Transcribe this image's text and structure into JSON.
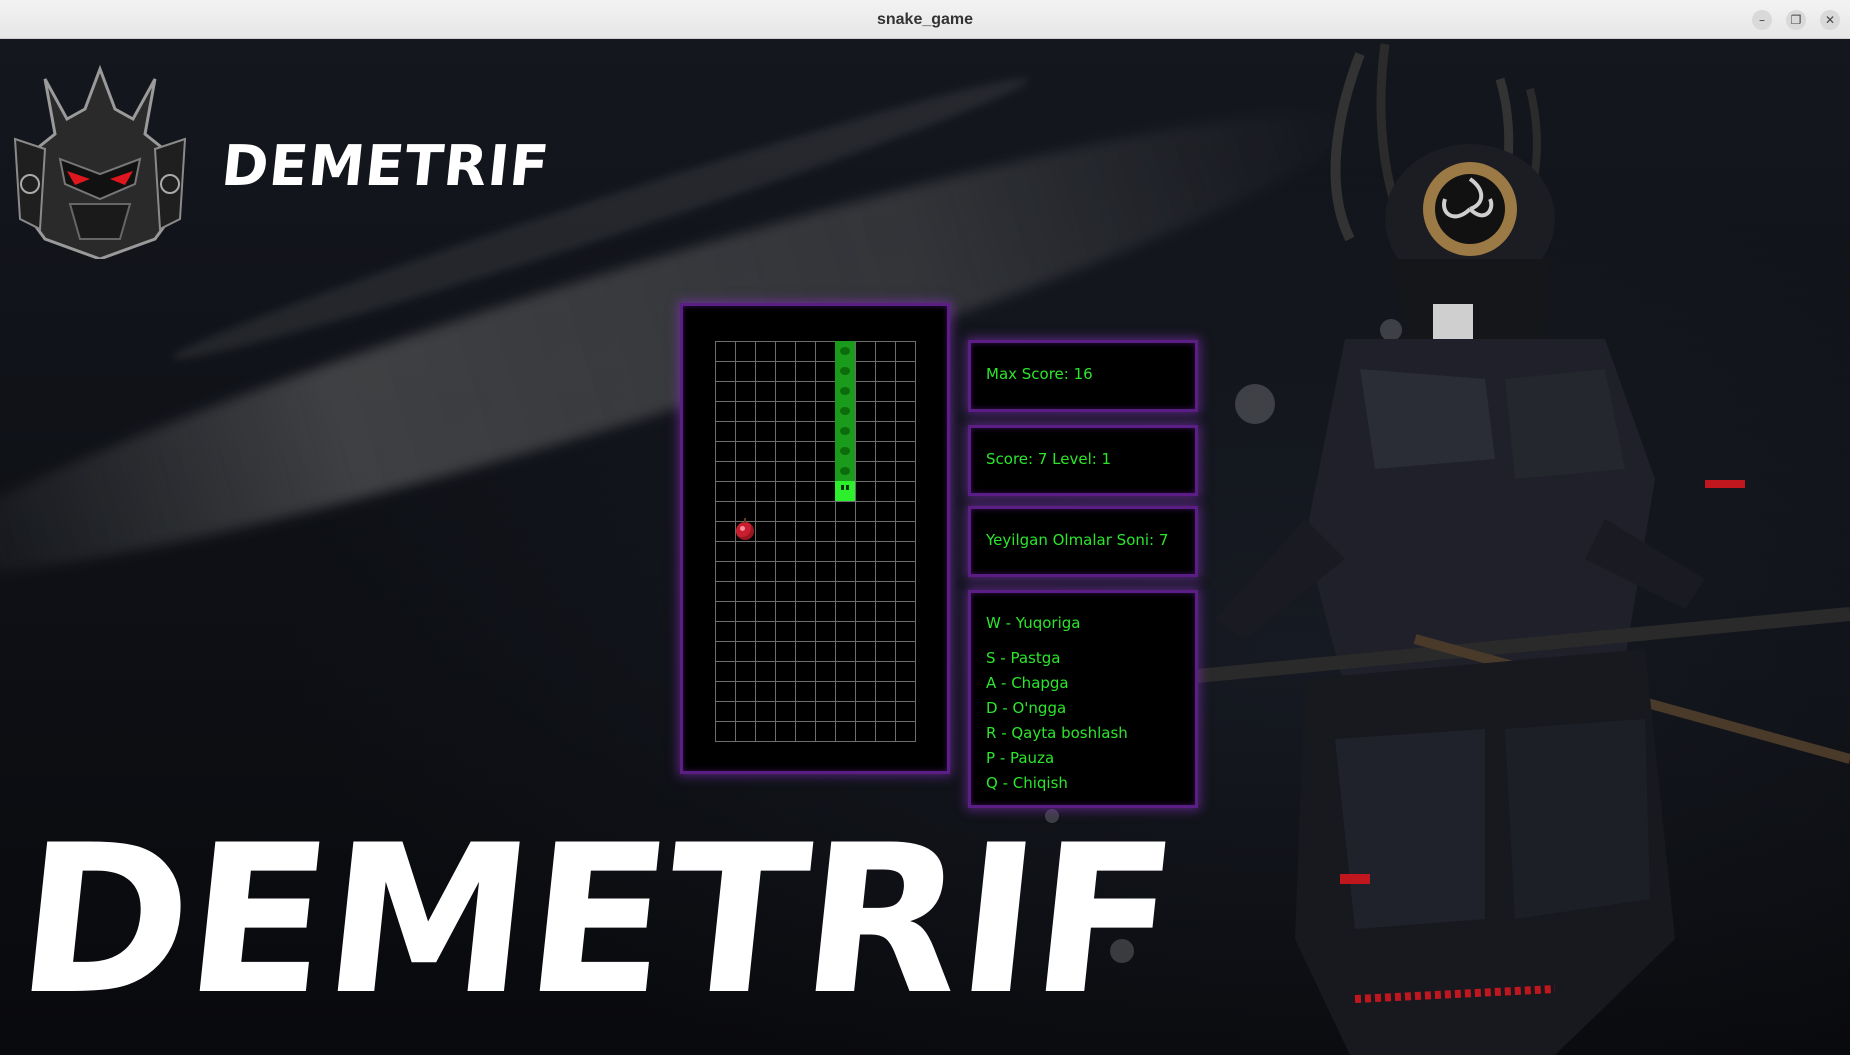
{
  "window": {
    "title": "snake_game"
  },
  "brand": {
    "small": "DEMETRIF",
    "large": "DEMETRIF"
  },
  "stats": {
    "max_score": "Max Score: 16",
    "score_level": "Score: 7  Level: 1",
    "eaten": "Yeyilgan Olmalar Soni: 7"
  },
  "controls": [
    "W - Yuqoriga",
    "S - Pastga",
    "A - Chapga",
    "D - O'ngga",
    "R - Qayta boshlash",
    "P - Pauza",
    "Q - Chiqish"
  ],
  "colors": {
    "panel_border": "#5b1e85",
    "text": "#2be62b",
    "snake_body": "#1b9b1b",
    "snake_head": "#2cf02c",
    "apple": "#c81e2e"
  },
  "game": {
    "grid_cols": 10,
    "grid_rows": 20,
    "snake_segments": [
      {
        "col": 6,
        "row": 0
      },
      {
        "col": 6,
        "row": 1
      },
      {
        "col": 6,
        "row": 2
      },
      {
        "col": 6,
        "row": 3
      },
      {
        "col": 6,
        "row": 4
      },
      {
        "col": 6,
        "row": 5
      },
      {
        "col": 6,
        "row": 6
      }
    ],
    "snake_head": {
      "col": 6,
      "row": 7
    },
    "apple": {
      "col": 1,
      "row": 9
    }
  },
  "icons": {
    "window_controls": [
      "minimize-icon",
      "restore-icon",
      "close-icon"
    ],
    "logo": "samurai-mask-logo"
  }
}
